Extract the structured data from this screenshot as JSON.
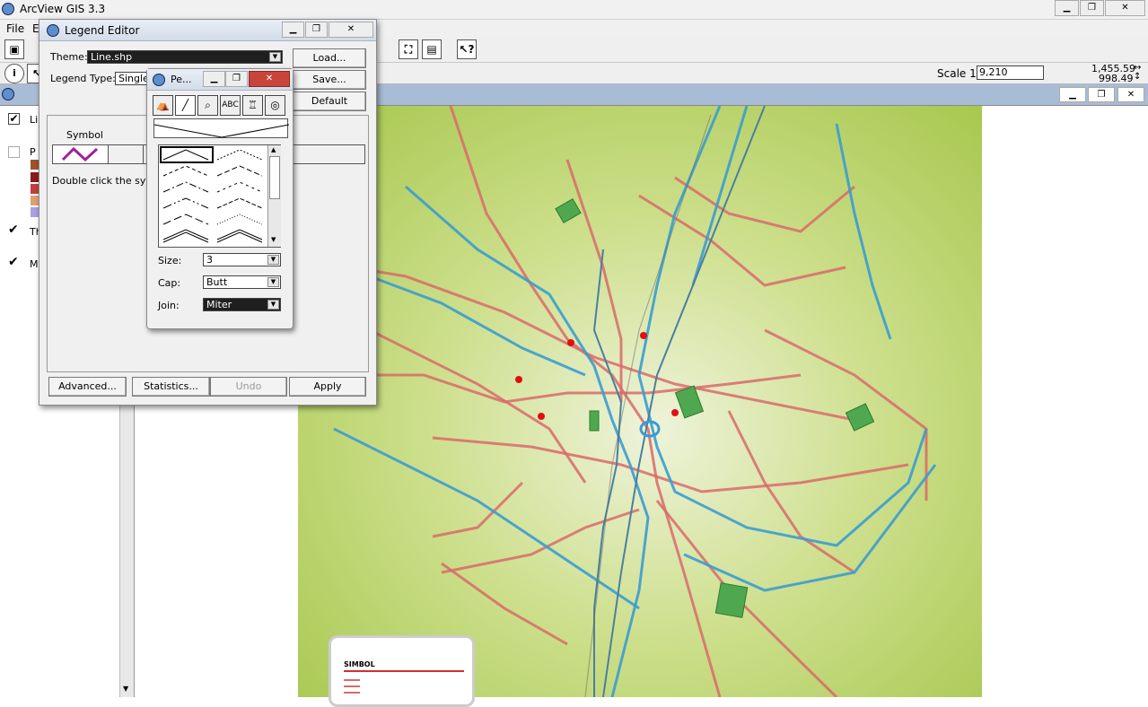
{
  "app": {
    "title": "ArcView GIS 3.3",
    "menu": [
      "File",
      "E"
    ]
  },
  "toolbar2": {
    "scale_label": "Scale 1:",
    "scale_value": "9,210",
    "coord_x": "1,455.59",
    "coord_y": "998.49"
  },
  "toc": {
    "items": [
      {
        "label": "Li",
        "checked": true
      },
      {
        "label": "P",
        "checked": false
      },
      {
        "label": "Th",
        "checked": true
      },
      {
        "label": "M",
        "checked": true
      }
    ],
    "swatch_colors": [
      "#a0522d",
      "#8b1a1a",
      "#c04040",
      "#e0a070",
      "#a9a0e0"
    ]
  },
  "legend_editor": {
    "title": "Legend Editor",
    "theme_label": "Theme:",
    "theme_value": "Line.shp",
    "legend_type_label": "Legend Type:",
    "legend_type_value": "Single",
    "load": "Load...",
    "save": "Save...",
    "default": "Default",
    "symbol_header": "Symbol",
    "instruction": "Double click the symb",
    "advanced": "Advanced...",
    "statistics": "Statistics...",
    "undo": "Undo",
    "apply": "Apply"
  },
  "pen_palette": {
    "title": "Pe...",
    "tab_icons": [
      "fill-tab-icon",
      "pen-tab-icon",
      "marker-tab-icon",
      "font-tab-icon",
      "palette-tab-icon",
      "color-tab-icon"
    ],
    "size_label": "Size:",
    "size_value": "3",
    "cap_label": "Cap:",
    "cap_value": "Butt",
    "join_label": "Join:",
    "join_value": "Miter"
  },
  "map": {
    "legend_title": "SIMBOL"
  }
}
